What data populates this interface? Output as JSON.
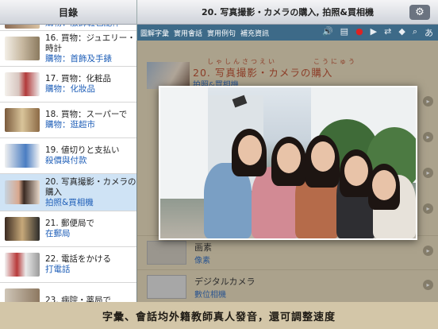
{
  "sidebar": {
    "title": "目錄",
    "items": [
      {
        "title": "",
        "sub": "購物：服飾鞋包配件"
      },
      {
        "title": "16. 買物：ジュエリー・時計",
        "sub": "購物：首飾及手錶"
      },
      {
        "title": "17. 買物：化粧品",
        "sub": "購物：化妝品"
      },
      {
        "title": "18. 買物：スーパーで",
        "sub": "購物：逛超市"
      },
      {
        "title": "19. 値切りと支払い",
        "sub": "殺價與付款"
      },
      {
        "title": "20. 写真撮影・カメラの購入",
        "sub": "拍照&買相機",
        "selected": true
      },
      {
        "title": "21. 郵便局で",
        "sub": "在郵局"
      },
      {
        "title": "22. 電話をかける",
        "sub": "打電話"
      },
      {
        "title": "23. 病院・薬局で",
        "sub": ""
      }
    ]
  },
  "main": {
    "title": "20. 写真撮影・カメラの購入, 拍照&買相機",
    "gear_icon": "gear-icon",
    "tabs": [
      "圖解字彙",
      "實用會話",
      "實用例句",
      "補充資訊"
    ],
    "toolbar_icons": [
      "speaker-icon",
      "doc-icon",
      "record-icon",
      "play-icon",
      "swap-icon",
      "tag-icon",
      "search-icon",
      "japanese-a-icon"
    ],
    "lesson_title": "20. 写真撮影・カメラの購入",
    "lesson_ruby1": "しゃしんさつえい",
    "lesson_ruby2": "こうにゅう",
    "lesson_sub": "拍照&買相機",
    "words": [
      {
        "jp": "画素",
        "zh": "像素"
      },
      {
        "jp": "デジタルカメラ",
        "zh": "數位相機"
      }
    ]
  },
  "caption": "字彙、會話均外籍教師真人發音，還可調整速度",
  "colors": {
    "accent": "#3d6a88",
    "title_red": "#b33a1a",
    "link_blue": "#1f5fb8"
  }
}
